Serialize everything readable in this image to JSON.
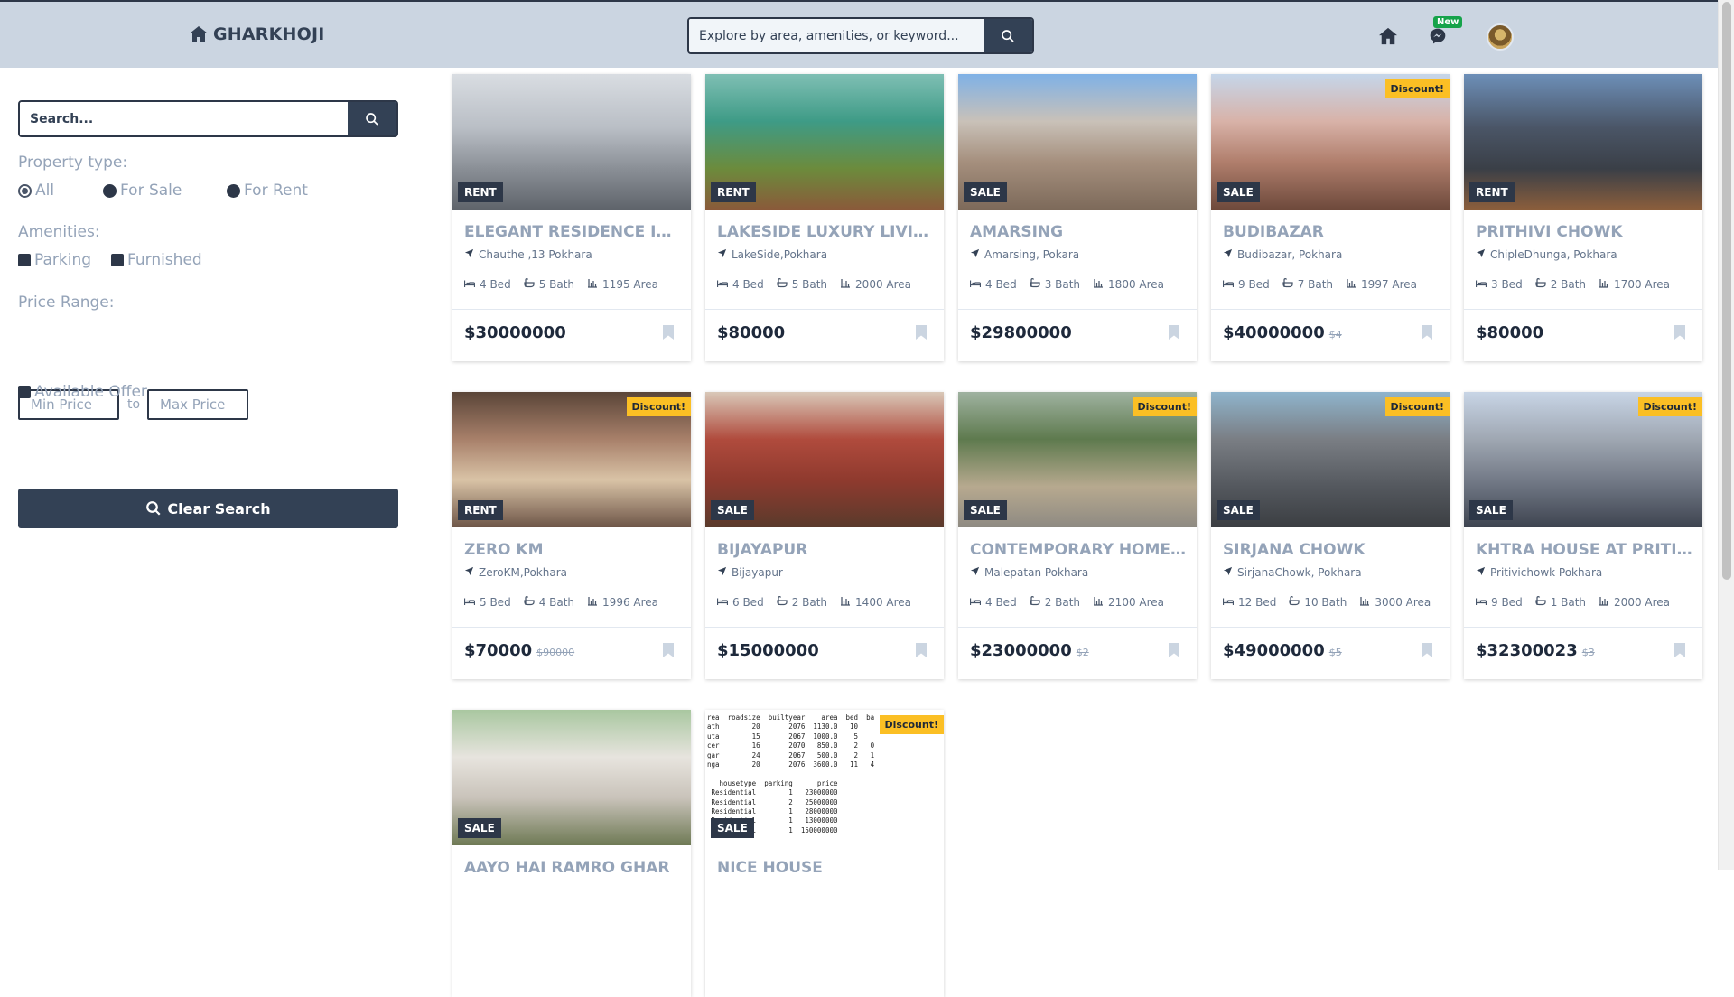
{
  "brand": {
    "name": "GHARKHOJI",
    "icon": "house-icon"
  },
  "header": {
    "search_placeholder": "Explore by area, amenities, or keyword...",
    "new_badge": "New"
  },
  "sidebar": {
    "search_placeholder": "Search...",
    "property_type_label": "Property type:",
    "property_types": [
      "All",
      "For Sale",
      "For Rent"
    ],
    "property_type_selected": "All",
    "amenities_label": "Amenities:",
    "amenities": [
      "Parking",
      "Furnished"
    ],
    "price_range_label": "Price Range:",
    "min_price_placeholder": "Min Price",
    "to_label": "to",
    "max_price_placeholder": "Max Price",
    "available_offer_label": "Available Offer",
    "clear_button": "Clear Search"
  },
  "colors": {
    "header_bg": "#cbd5e1",
    "dark": "#334155",
    "discount": "#fbbf24",
    "muted": "#94a3b8"
  },
  "cards": [
    {
      "tag": "RENT",
      "discount": "",
      "title": "ELEGANT RESIDENCE IN C...",
      "location": "Chauthe ,13 Pokhara",
      "bed": "4 Bed",
      "bath": "5 Bath",
      "area": "1195 Area",
      "price": "$30000000",
      "old_price": ""
    },
    {
      "tag": "RENT",
      "discount": "",
      "title": "LAKESIDE LUXURY LIVING",
      "location": "LakeSide,Pokhara",
      "bed": "4 Bed",
      "bath": "5 Bath",
      "area": "2000 Area",
      "price": "$80000",
      "old_price": ""
    },
    {
      "tag": "SALE",
      "discount": "",
      "title": "AMARSING",
      "location": "Amarsing, Pokara",
      "bed": "4 Bed",
      "bath": "3 Bath",
      "area": "1800 Area",
      "price": "$29800000",
      "old_price": ""
    },
    {
      "tag": "SALE",
      "discount": "Discount!",
      "title": "BUDIBAZAR",
      "location": "Budibazar, Pokhara",
      "bed": "9 Bed",
      "bath": "7 Bath",
      "area": "1997 Area",
      "price": "$40000000",
      "old_price": "$4"
    },
    {
      "tag": "RENT",
      "discount": "",
      "title": "PRITHIVI CHOWK",
      "location": "ChipleDhunga, Pokhara",
      "bed": "3 Bed",
      "bath": "2 Bath",
      "area": "1700 Area",
      "price": "$80000",
      "old_price": ""
    },
    {
      "tag": "RENT",
      "discount": "Discount!",
      "title": "ZERO KM",
      "location": "ZeroKM,Pokhara",
      "bed": "5 Bed",
      "bath": "4 Bath",
      "area": "1996 Area",
      "price": "$70000",
      "old_price": "$90000"
    },
    {
      "tag": "SALE",
      "discount": "",
      "title": "BIJAYAPUR",
      "location": "Bijayapur",
      "bed": "6 Bed",
      "bath": "2 Bath",
      "area": "1400 Area",
      "price": "$15000000",
      "old_price": ""
    },
    {
      "tag": "SALE",
      "discount": "Discount!",
      "title": "CONTEMPORARY HOME IN...",
      "location": "Malepatan Pokhara",
      "bed": "4 Bed",
      "bath": "2 Bath",
      "area": "2100 Area",
      "price": "$23000000",
      "old_price": "$2"
    },
    {
      "tag": "SALE",
      "discount": "Discount!",
      "title": "SIRJANA CHOWK",
      "location": "SirjanaChowk, Pokhara",
      "bed": "12 Bed",
      "bath": "10 Bath",
      "area": "3000 Area",
      "price": "$49000000",
      "old_price": "$5"
    },
    {
      "tag": "SALE",
      "discount": "Discount!",
      "title": "KHTRA HOUSE AT PRITIVI...",
      "location": "Pritivichowk Pokhara",
      "bed": "9 Bed",
      "bath": "1 Bath",
      "area": "2000 Area",
      "price": "$32300023",
      "old_price": "$3"
    },
    {
      "tag": "SALE",
      "discount": "",
      "title": "AAYO HAI RAMRO GHAR",
      "location": "",
      "bed": "",
      "bath": "",
      "area": "",
      "price": "",
      "old_price": ""
    },
    {
      "tag": "SALE",
      "discount": "Discount!",
      "title": "NICE HOUSE",
      "location": "",
      "bed": "",
      "bath": "",
      "area": "",
      "price": "",
      "old_price": ""
    }
  ],
  "table_image": {
    "lines": [
      "rea  roadsize  builtyear    area  bed  ba",
      "ath        20       2076  1130.0   10   ",
      "uta        15       2067  1000.0    5   ",
      "cer        16       2070   850.0    2   0",
      "gar        24       2067   500.0    2   1",
      "nga        20       2076  3600.0   11   4",
      "",
      "   housetype  parking      price",
      " Residential        1   23000000",
      " Residential        2   25000000",
      " Residential        1   28000000",
      " Residential        1   13000000",
      " Residential        1  150000000"
    ]
  }
}
